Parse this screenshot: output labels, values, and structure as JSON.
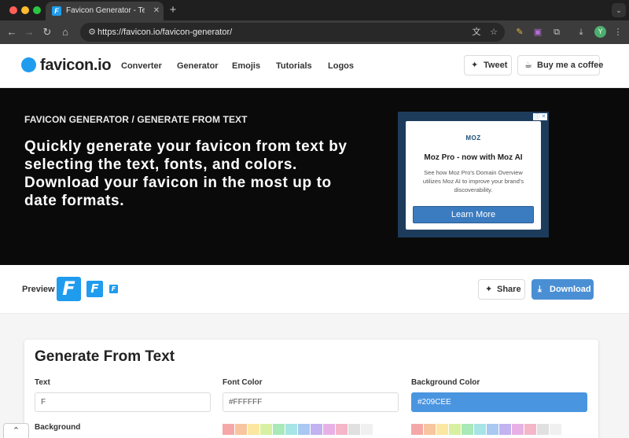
{
  "browser": {
    "tab_title": "Favicon Generator - Text to F",
    "tab_favicon_letter": "F",
    "url": "https://favicon.io/favicon-generator/",
    "avatar_letter": "Y",
    "icons": [
      "back-icon",
      "forward-icon",
      "reload-icon",
      "home-icon",
      "tune-icon",
      "translate-icon",
      "star-icon",
      "extensions-icon",
      "download-icon",
      "kebab-menu-icon"
    ]
  },
  "site": {
    "logo": "favicon.io",
    "nav": [
      "Converter",
      "Generator",
      "Emojis",
      "Tutorials",
      "Logos"
    ],
    "tweet_label": "Tweet",
    "coffee_label": "Buy me a coffee"
  },
  "hero": {
    "kicker": "FAVICON GENERATOR / GENERATE FROM TEXT",
    "headline": "Quickly generate your favicon from text by selecting the text, fonts, and colors. Download your favicon in the most up to date formats."
  },
  "ad": {
    "brand": "MOZ",
    "title": "Moz Pro - now with Moz AI",
    "body": "See how Moz Pro's Domain Overview utilizes Moz AI to improve your brand's discoverability.",
    "cta": "Learn More"
  },
  "preview": {
    "label": "Preview",
    "letter": "F",
    "share_label": "Share",
    "download_label": "Download"
  },
  "generator": {
    "title": "Generate From Text",
    "fields": [
      {
        "label": "Text",
        "value": "F"
      },
      {
        "label": "Font Color",
        "value": "#FFFFFF"
      },
      {
        "label": "Background Color",
        "value": "#209CEE"
      }
    ],
    "background_label": "Background"
  },
  "colors": {
    "accent": "#209CEE",
    "hero_bg": "#0A0A0A",
    "download_btn": "#4A8FD4",
    "swatches": [
      "#f4a9a8",
      "#f7c59f",
      "#fbe7a1",
      "#d7f0a2",
      "#a9e8b8",
      "#a6e4e6",
      "#a9c8f2",
      "#c2b2f0",
      "#e8b1e6",
      "#f4b6c8",
      "#e0e0e0",
      "#f0f0f0",
      "#ffffff"
    ]
  }
}
